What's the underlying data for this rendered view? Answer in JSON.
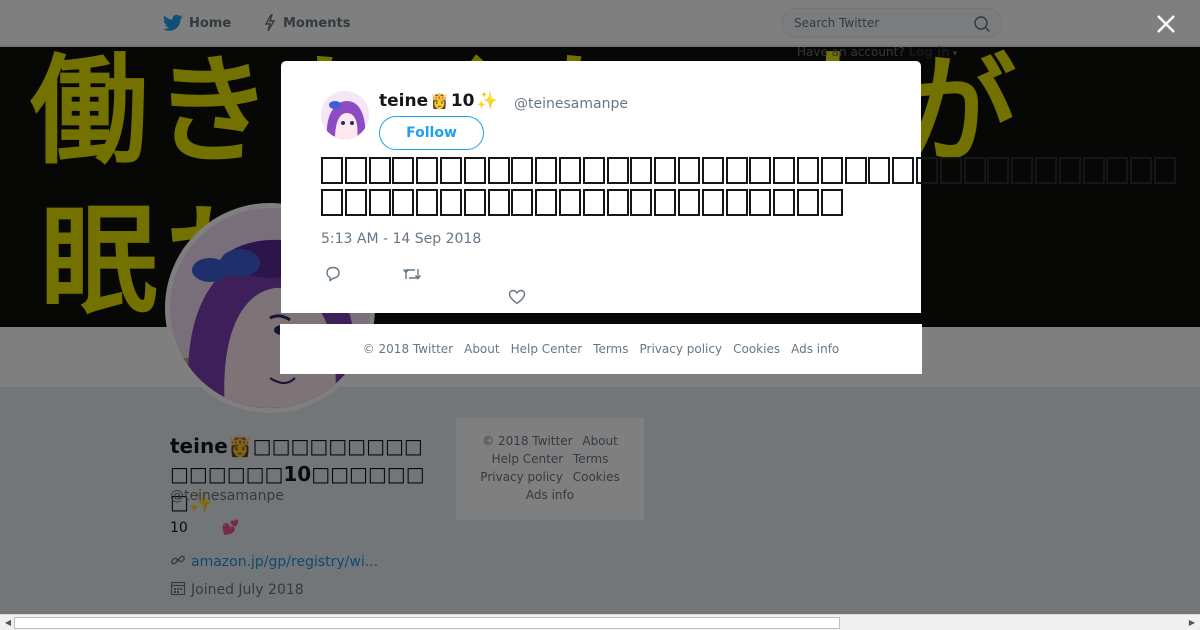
{
  "nav": {
    "home_label": "Home",
    "moments_label": "Moments",
    "search_placeholder": "Search Twitter",
    "have_account_text": "Have an account?",
    "login_label": "Log in"
  },
  "banner": {
    "line1": "働きたくない人が",
    "line2": "眠れていますす"
  },
  "profile": {
    "display_name": "teine👸□□□□□□□□□□□□□□□10□□□□□□□✨",
    "screen_name": "@teinesamanpe",
    "bio_number": "10",
    "bio_emoji": "💕",
    "link": "amazon.jp/gp/registry/wi...",
    "joined": "Joined July 2018"
  },
  "side_footer": {
    "copyright": "© 2018 Twitter",
    "about": "About",
    "help": "Help Center",
    "terms": "Terms",
    "privacy": "Privacy policy",
    "cookies": "Cookies",
    "ads": "Ads info"
  },
  "tweet": {
    "name": "teine",
    "name_emoji": "👸",
    "name_number": "10",
    "name_sparkle": "✨",
    "handle": "@teinesamanpe",
    "follow_label": "Follow",
    "line1_glyph_count": 36,
    "line2_glyph_count": 22,
    "timestamp": "5:13 AM - 14 Sep 2018"
  },
  "modal_footer": {
    "copyright": "© 2018 Twitter",
    "about": "About",
    "help": "Help Center",
    "terms": "Terms",
    "privacy": "Privacy policy",
    "cookies": "Cookies",
    "ads": "Ads info"
  },
  "colors": {
    "twitter_blue": "#1da1f2",
    "banner_text": "#e6e200",
    "heart_red": "#c0263d"
  },
  "icons": [
    "twitter-bird-icon",
    "lightning-icon",
    "search-icon",
    "close-icon",
    "reply-icon",
    "retweet-icon",
    "like-icon",
    "link-icon",
    "calendar-icon"
  ]
}
